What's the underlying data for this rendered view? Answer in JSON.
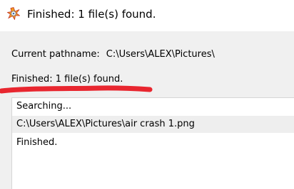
{
  "window": {
    "title": "Finished: 1 file(s) found.",
    "app_icon": "searchmyfiles-icon"
  },
  "info": {
    "pathname_label": "Current pathname:",
    "pathname_value": "C:\\Users\\ALEX\\Pictures\\",
    "status": "Finished: 1 file(s) found."
  },
  "annotation": {
    "stroke_color": "#e8262f"
  },
  "log": {
    "rows": [
      "Searching...",
      "C:\\Users\\ALEX\\Pictures\\air crash 1.png",
      "Finished."
    ]
  }
}
